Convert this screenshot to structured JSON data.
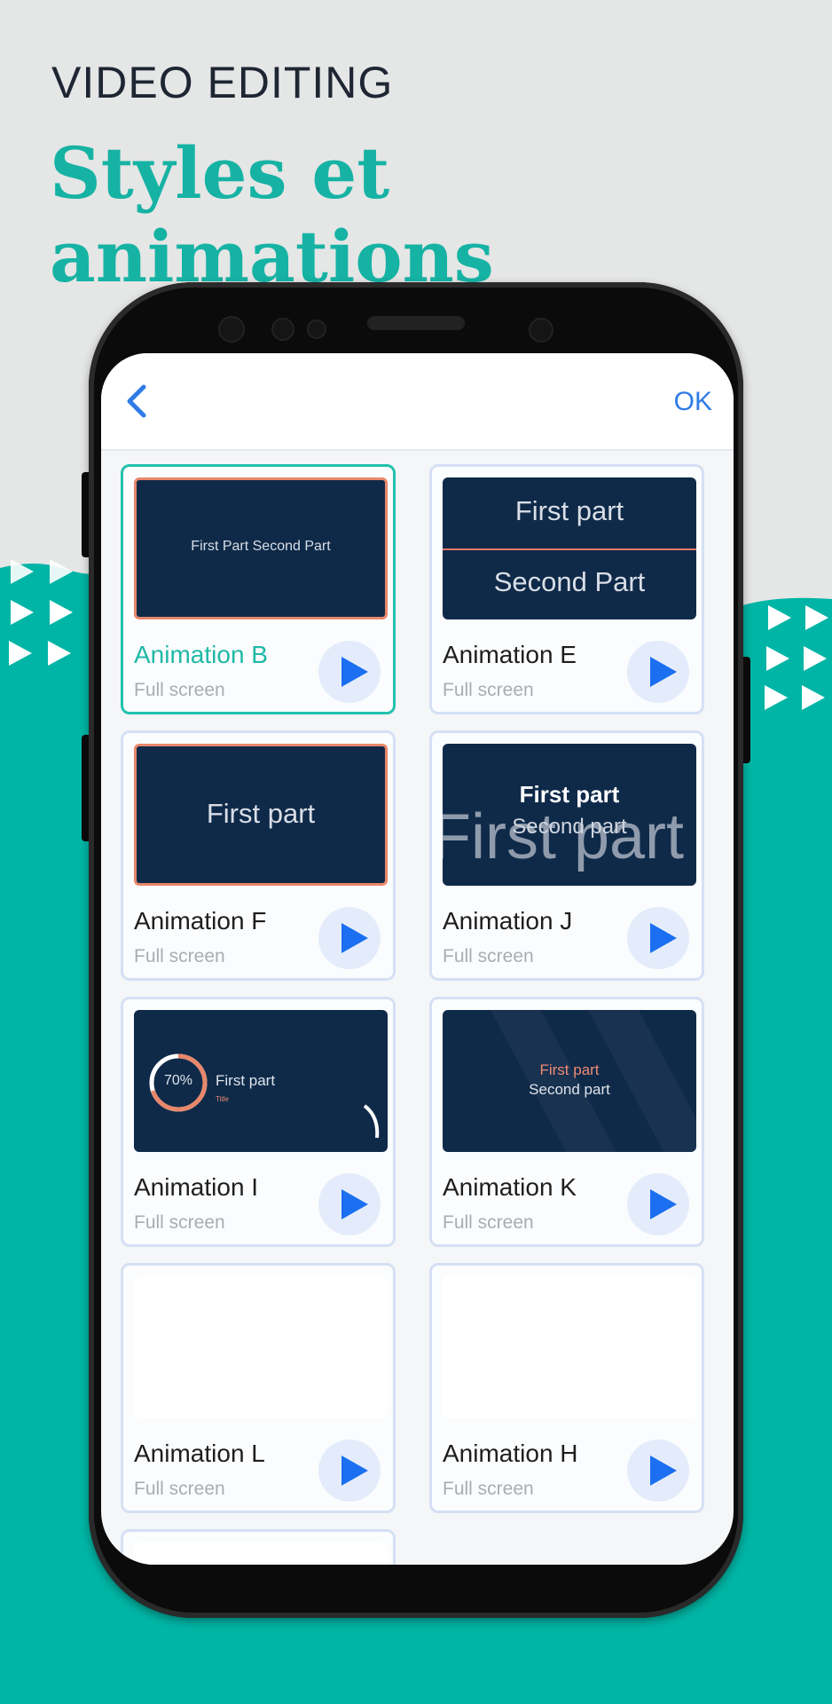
{
  "header": {
    "kicker": "VIDEO EDITING",
    "headline": "Styles et animations"
  },
  "colors": {
    "background": "#e5e6e6",
    "teal": "#00b5a5",
    "accent_title": "#16b3a4",
    "play_button": "#1b6ff0",
    "thumb_navy": "#0f2a49",
    "coral": "#e8876b"
  },
  "navbar": {
    "back_icon": "chevron-left-icon",
    "ok_label": "OK"
  },
  "cards": [
    {
      "title": "Animation B",
      "subtitle": "Full screen",
      "thumb_text": "First Part Second Part",
      "selected": true
    },
    {
      "title": "Animation E",
      "subtitle": "Full screen",
      "thumb_top": "First part",
      "thumb_bottom": "Second Part"
    },
    {
      "title": "Animation F",
      "subtitle": "Full screen",
      "thumb_text": "First part"
    },
    {
      "title": "Animation J",
      "subtitle": "Full screen",
      "thumb_bold": "First part",
      "thumb_sub": "Second part",
      "thumb_ghost": "First part"
    },
    {
      "title": "Animation I",
      "subtitle": "Full screen",
      "thumb_percent": "70%",
      "thumb_label": "First part",
      "thumb_small": "Title",
      "progress": 0.7
    },
    {
      "title": "Animation K",
      "subtitle": "Full screen",
      "thumb_top": "First part",
      "thumb_bottom": "Second part"
    },
    {
      "title": "Animation L",
      "subtitle": "Full screen"
    },
    {
      "title": "Animation H",
      "subtitle": "Full screen"
    }
  ]
}
